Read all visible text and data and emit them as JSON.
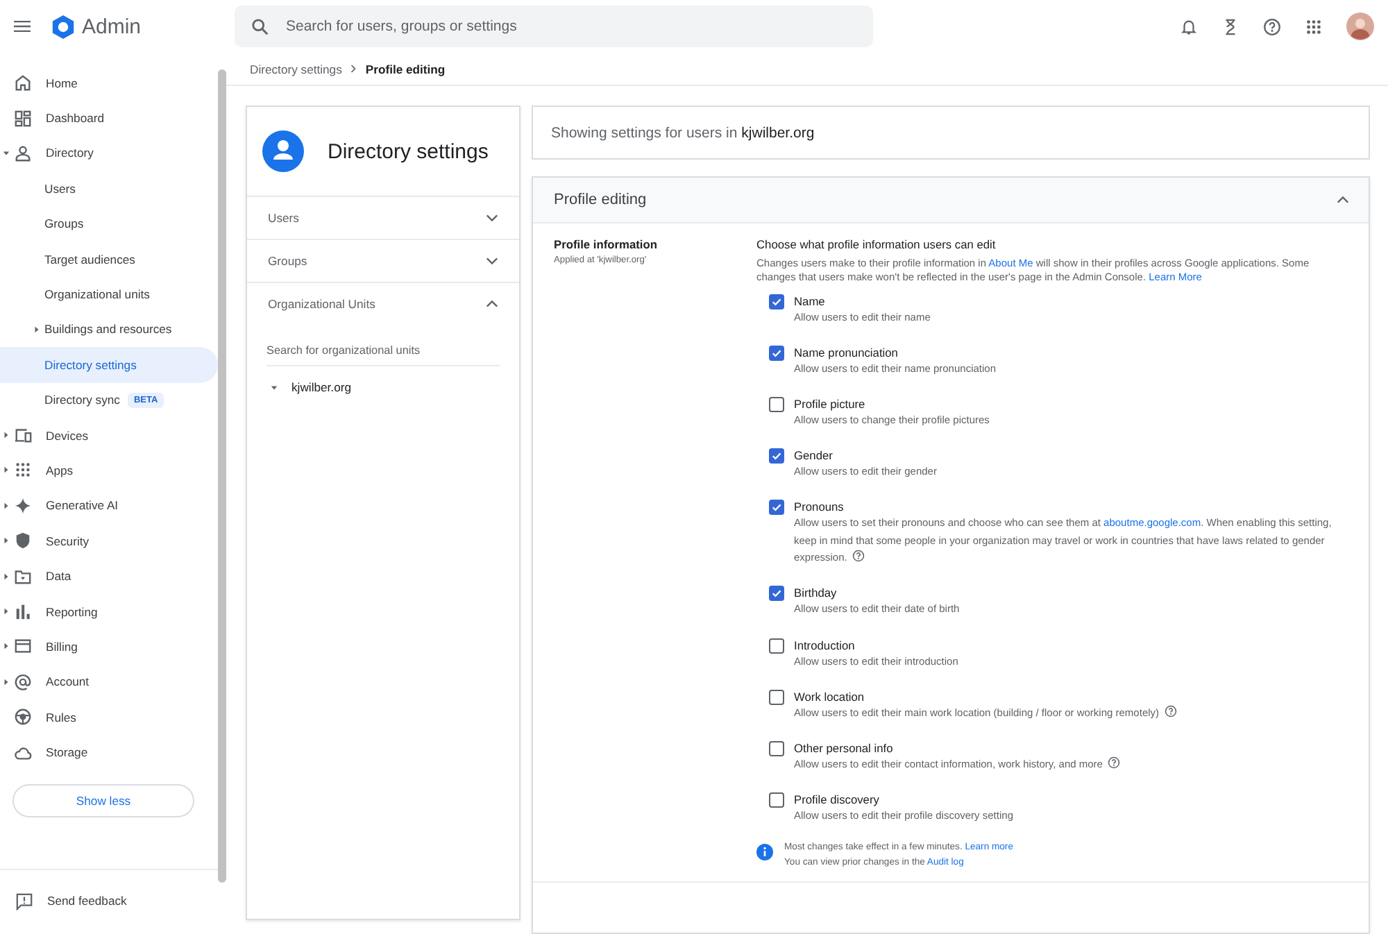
{
  "app": {
    "title": "Admin"
  },
  "search": {
    "placeholder": "Search for users, groups or settings"
  },
  "nav": [
    {
      "label": "Home",
      "selected": false
    },
    {
      "label": "Dashboard",
      "selected": false
    },
    {
      "label": "Directory",
      "selected": false,
      "expanded": true,
      "children": [
        {
          "label": "Users",
          "selected": false
        },
        {
          "label": "Groups",
          "selected": false
        },
        {
          "label": "Target audiences",
          "selected": false
        },
        {
          "label": "Organizational units",
          "selected": false
        },
        {
          "label": "Buildings and resources",
          "selected": false,
          "expanded": false
        },
        {
          "label": "Directory settings",
          "selected": true
        },
        {
          "label": "Directory sync",
          "selected": false,
          "badge": "BETA"
        }
      ]
    },
    {
      "label": "Devices",
      "selected": false,
      "expanded": false
    },
    {
      "label": "Apps",
      "selected": false,
      "expanded": false
    },
    {
      "label": "Generative AI",
      "selected": false,
      "expanded": false
    },
    {
      "label": "Security",
      "selected": false,
      "expanded": false
    },
    {
      "label": "Data",
      "selected": false,
      "expanded": false
    },
    {
      "label": "Reporting",
      "selected": false,
      "expanded": false
    },
    {
      "label": "Billing",
      "selected": false,
      "expanded": false
    },
    {
      "label": "Account",
      "selected": false,
      "expanded": false
    },
    {
      "label": "Rules",
      "selected": false
    },
    {
      "label": "Storage",
      "selected": false
    }
  ],
  "show_less": "Show less",
  "feedback": "Send feedback",
  "breadcrumb": [
    "Directory settings",
    "Profile editing"
  ],
  "left_card": {
    "title": "Directory settings",
    "sections": [
      {
        "label": "Users",
        "expanded": false
      },
      {
        "label": "Groups",
        "expanded": false
      },
      {
        "label": "Organizational Units",
        "expanded": true
      }
    ],
    "ou_search": {
      "placeholder": "Search for organizational units"
    },
    "ou_tree": [
      {
        "label": "kjwilber.org",
        "expanded": true
      }
    ]
  },
  "showing": "Showing settings for users in **kjwilber.org**",
  "panel": {
    "title": "Profile editing",
    "expanded": true,
    "setting": {
      "name": "Profile information",
      "applied": "Applied at 'kjwilber.org'"
    },
    "heading": "Choose what profile information users can edit",
    "intro": [
      {
        "text": "Changes users make to their profile information in "
      },
      {
        "link": "About Me"
      },
      {
        "text": " will show in their profiles across Google applications. Some changes that users make won't be reflected in the user's page in the Admin Console. "
      },
      {
        "link": "Learn More"
      }
    ],
    "options": [
      {
        "label": "Name",
        "checked": true,
        "description": [
          {
            "text": "Allow users to edit their name"
          }
        ]
      },
      {
        "label": "Name pronunciation",
        "checked": true,
        "description": [
          {
            "text": "Allow users to edit their name pronunciation"
          }
        ]
      },
      {
        "label": "Profile picture",
        "checked": false,
        "description": [
          {
            "text": "Allow users to change their profile pictures"
          }
        ]
      },
      {
        "label": "Gender",
        "checked": true,
        "description": [
          {
            "text": "Allow users to edit their gender"
          }
        ]
      },
      {
        "label": "Pronouns",
        "checked": true,
        "help": true,
        "description": [
          {
            "text": "Allow users to set their pronouns and choose who can see them at "
          },
          {
            "link": "aboutme.google.com"
          },
          {
            "text": ". When enabling this setting, keep in mind that some people in your organization may travel or work in countries that have laws related to gender expression."
          }
        ]
      },
      {
        "label": "Birthday",
        "checked": true,
        "description": [
          {
            "text": "Allow users to edit their date of birth"
          }
        ]
      },
      {
        "label": "Introduction",
        "checked": false,
        "description": [
          {
            "text": "Allow users to edit their introduction"
          }
        ]
      },
      {
        "label": "Work location",
        "checked": false,
        "help": true,
        "description": [
          {
            "text": "Allow users to edit their main work location (building / floor or working remotely)"
          }
        ]
      },
      {
        "label": "Other personal info",
        "checked": false,
        "help": true,
        "description": [
          {
            "text": "Allow users to edit their contact information, work history, and more"
          }
        ]
      },
      {
        "label": "Profile discovery",
        "checked": false,
        "description": [
          {
            "text": "Allow users to edit their profile discovery setting"
          }
        ]
      }
    ],
    "notes": [
      [
        {
          "text": "Most changes take effect in a few minutes. "
        },
        {
          "link": "Learn more"
        }
      ],
      [
        {
          "text": "You can view prior changes in the "
        },
        {
          "link": "Audit log"
        }
      ]
    ]
  }
}
